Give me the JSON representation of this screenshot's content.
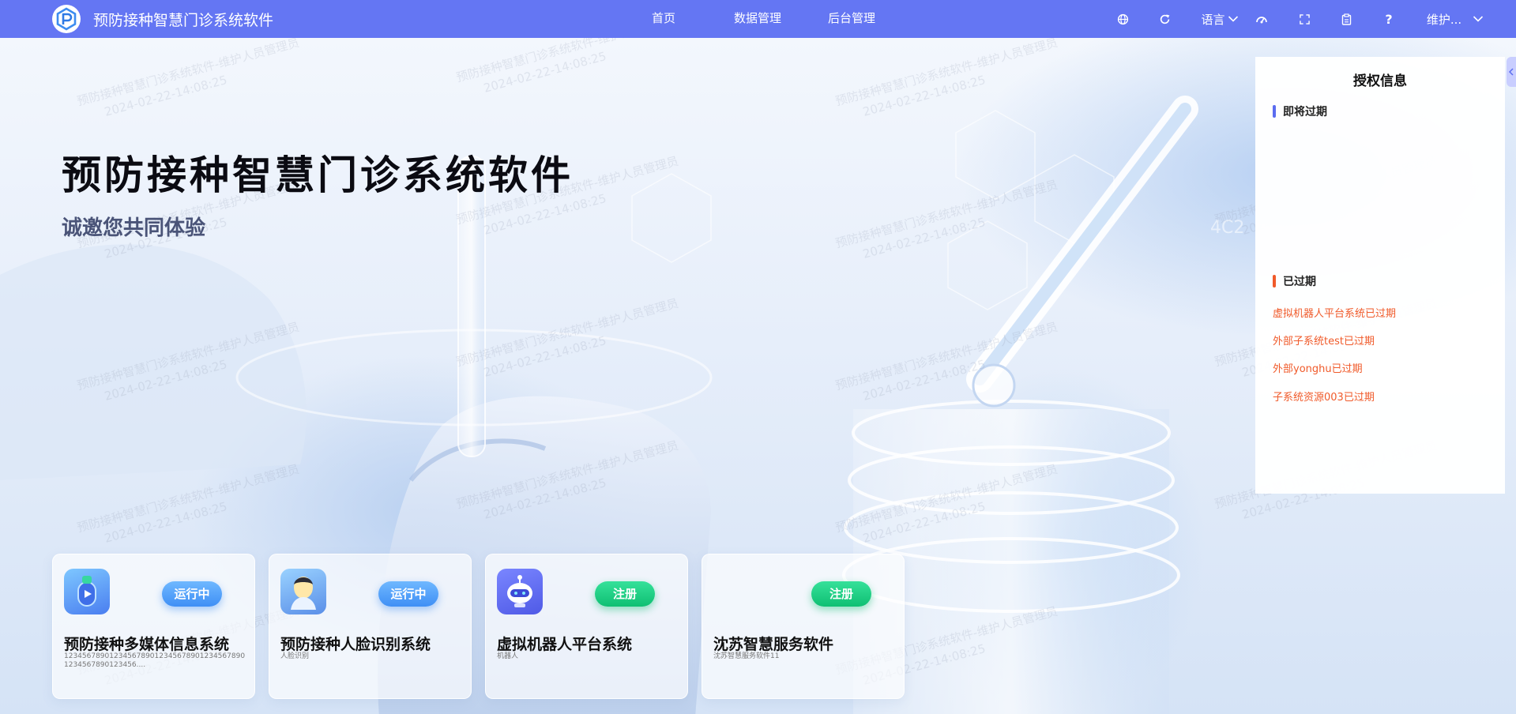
{
  "header": {
    "app_title": "预防接种智慧门诊系统软件",
    "nav": [
      "首页",
      "数据管理",
      "后台管理"
    ],
    "tools": {
      "globe_icon": "globe-icon",
      "refresh_icon": "refresh-icon",
      "language_label": "语言",
      "theme_icon": "palette-icon",
      "fullscreen_icon": "fullscreen-icon",
      "clipboard_icon": "clipboard-icon",
      "help_label": "?",
      "user_label": "维护..."
    }
  },
  "hero": {
    "title": "预防接种智慧门诊系统软件",
    "subtitle": "诚邀您共同体验",
    "faint_label": "4C2",
    "watermark_line1": "预防接种智慧门诊系统软件-维护人员管理员",
    "watermark_line2": "2024-02-22-14:08:25"
  },
  "license_panel": {
    "title": "授权信息",
    "expiring_label": "即将过期",
    "expiring_items": [],
    "expired_label": "已过期",
    "expired_items": [
      "虚拟机器人平台系统已过期",
      "外部子系统test已过期",
      "外部yonghu已过期",
      "子系统资源003已过期"
    ]
  },
  "cards": [
    {
      "name": "预防接种多媒体信息系统",
      "status": "运行中",
      "status_type": "running",
      "desc": "12345678901234567890123456789012345678901234567890123456....",
      "icon": "media-player-icon"
    },
    {
      "name": "预防接种人脸识别系统",
      "status": "运行中",
      "status_type": "running",
      "desc": "人脸识别",
      "icon": "face-recognition-icon"
    },
    {
      "name": "虚拟机器人平台系统",
      "status": "注册",
      "status_type": "register",
      "desc": "机器人",
      "icon": "robot-icon"
    },
    {
      "name": "沈苏智慧服务软件",
      "status": "注册",
      "status_type": "register",
      "desc": "沈苏智慧服务软件11",
      "icon": ""
    }
  ],
  "colors": {
    "header_bg": "#6476f3",
    "expiring_accent": "#5b6cf0",
    "expired_accent": "#f05a2a",
    "running_badge": "#3f8ff5",
    "register_badge": "#0fbf72"
  }
}
